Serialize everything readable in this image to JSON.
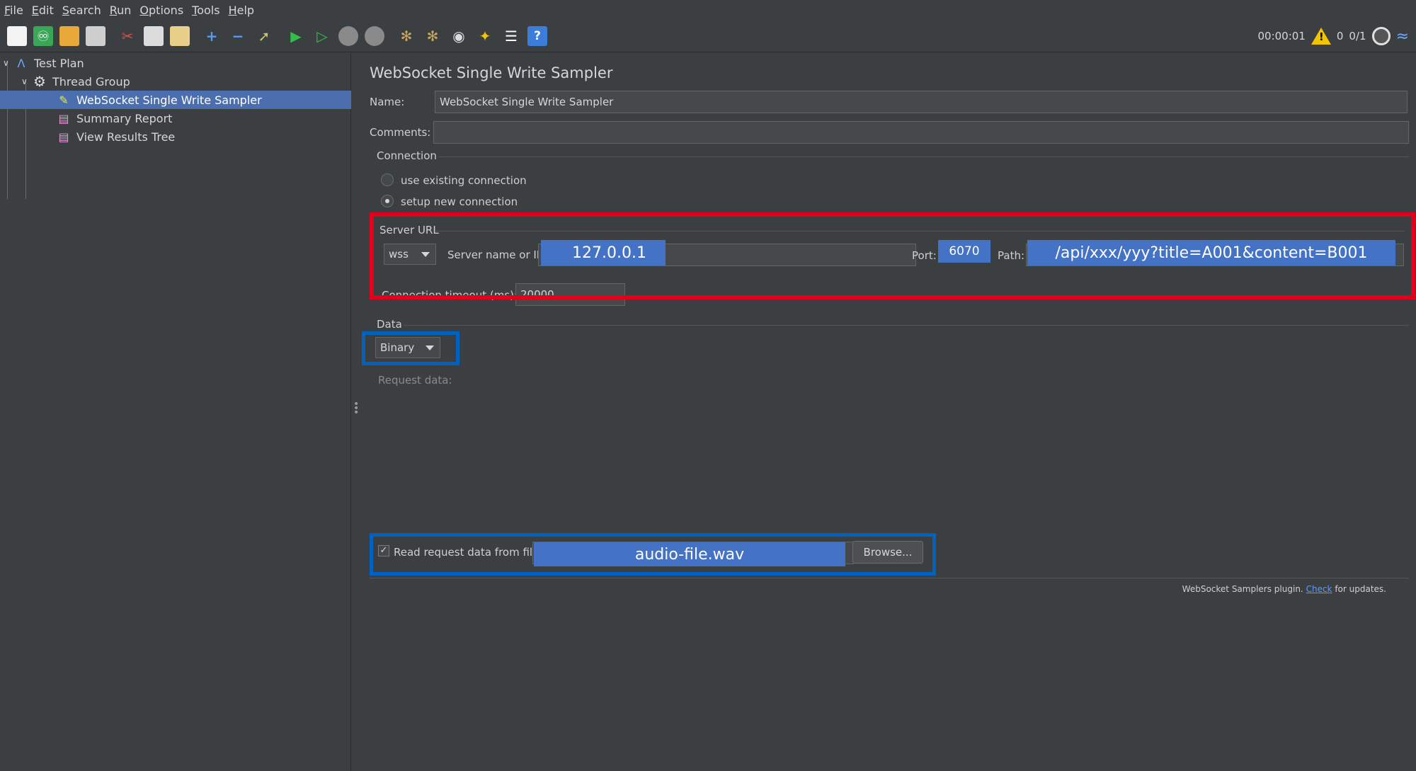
{
  "menu": [
    "File",
    "Edit",
    "Search",
    "Run",
    "Options",
    "Tools",
    "Help"
  ],
  "toolbar": {
    "icons": [
      "new-icon",
      "templates-icon",
      "open-icon",
      "save-icon",
      "cut-icon",
      "copy-icon",
      "paste-icon",
      "expand-icon",
      "collapse-icon",
      "toggle-icon",
      "start-icon",
      "start-no-pause-icon",
      "stop-icon",
      "shutdown-icon",
      "clear-icon",
      "clear-all-icon",
      "search-icon",
      "reset-search-icon",
      "function-helper-icon",
      "help-icon"
    ],
    "timer": "00:00:01",
    "warnings": "0",
    "threads": "0/1"
  },
  "tree": {
    "test_plan": "Test Plan",
    "thread_group": "Thread Group",
    "sampler": "WebSocket Single Write Sampler",
    "summary_report": "Summary Report",
    "view_results_tree": "View Results Tree"
  },
  "panel": {
    "title": "WebSocket Single Write Sampler",
    "name_label": "Name:",
    "name_value": "WebSocket Single Write Sampler",
    "comments_label": "Comments:",
    "comments_value": "",
    "connection_title": "Connection",
    "radio_existing": "use existing connection",
    "radio_new": "setup new connection",
    "server_url_title": "Server URL",
    "protocol": "wss",
    "server_label": "Server name or IP:",
    "server_value": "127.0.0.1",
    "port_label": "Port:",
    "port_value": "6070",
    "path_label": "Path:",
    "path_value": "/api/xxx/yyy?title=A001&content=B001",
    "timeout_label": "Connection timeout (ms):",
    "timeout_value": "20000",
    "data_title": "Data",
    "data_type": "Binary",
    "request_data_label": "Request data:",
    "read_file_label": "Read request data from file:",
    "file_value": "audio-file.wav",
    "browse_label": "Browse..."
  },
  "footer": {
    "prefix": "WebSocket Samplers plugin.",
    "link": "Check",
    "suffix": "for updates."
  },
  "colors": {
    "highlight_red": "#e3001b",
    "highlight_blue": "#0062bf",
    "selection": "#4b6eaf",
    "field_highlight": "#4472c4"
  }
}
